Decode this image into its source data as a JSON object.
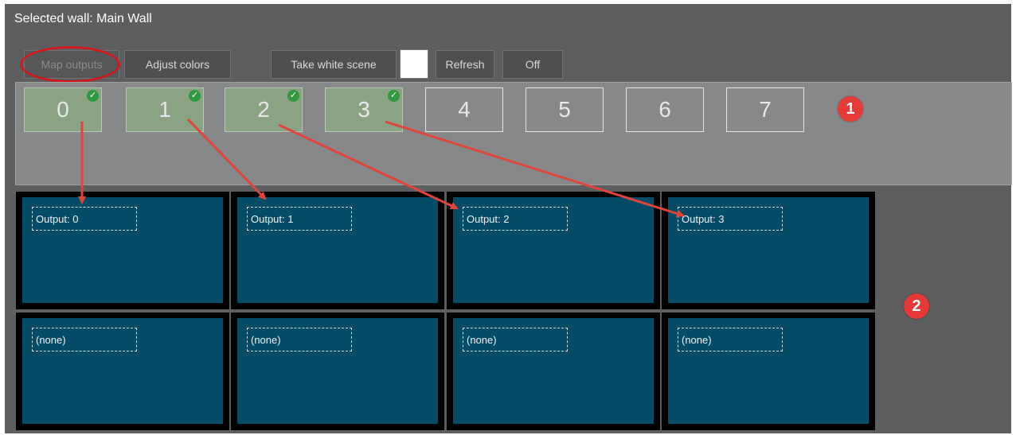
{
  "header": {
    "title": "Selected wall: Main Wall"
  },
  "toolbar": {
    "map_outputs": "Map outputs",
    "adjust_colors": "Adjust colors",
    "take_white_scene": "Take white scene",
    "refresh": "Refresh",
    "off": "Off",
    "swatch_color": "#ffffff"
  },
  "outputs": [
    {
      "label": "0",
      "mapped": true
    },
    {
      "label": "1",
      "mapped": true
    },
    {
      "label": "2",
      "mapped": true
    },
    {
      "label": "3",
      "mapped": true
    },
    {
      "label": "4",
      "mapped": false
    },
    {
      "label": "5",
      "mapped": false
    },
    {
      "label": "6",
      "mapped": false
    },
    {
      "label": "7",
      "mapped": false
    }
  ],
  "grid": [
    [
      "Output: 0",
      "Output: 1",
      "Output: 2",
      "Output: 3"
    ],
    [
      "(none)",
      "(none)",
      "(none)",
      "(none)"
    ]
  ],
  "annotations": {
    "marker1": "1",
    "marker2": "2",
    "arrow_color": "#e0453b",
    "circle_color": "#d0191b"
  },
  "colors": {
    "tile_fill": "#044b66",
    "mapped_fill": "#8aa383",
    "check": "#2f9a3d"
  }
}
